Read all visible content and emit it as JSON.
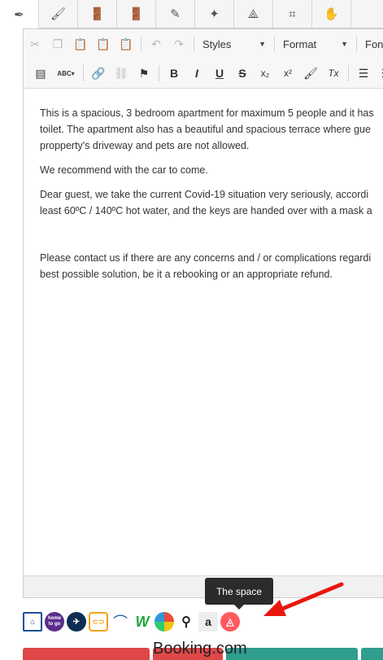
{
  "tabs": [
    {
      "icon": "pen-nib-icon",
      "glyph": "✒"
    },
    {
      "icon": "brush-icon",
      "glyph": "🖌"
    },
    {
      "icon": "door-icon",
      "glyph": "🚪"
    },
    {
      "icon": "door-open-icon",
      "glyph": "🚪"
    },
    {
      "icon": "pencil-icon",
      "glyph": "✎"
    },
    {
      "icon": "magic-wand-icon",
      "glyph": "✦"
    },
    {
      "icon": "drafting-compass-icon",
      "glyph": "⟁"
    },
    {
      "icon": "crop-icon",
      "glyph": "⌗"
    },
    {
      "icon": "hand-icon",
      "glyph": "✋"
    }
  ],
  "toolbar": {
    "styles_label": "Styles",
    "format_label": "Format",
    "font_label": "Font",
    "spell_label": "ABC",
    "bold": "B",
    "italic": "I",
    "underline": "U",
    "strike": "S",
    "subscript": "x₂",
    "superscript": "x²",
    "clear_format": "Tx"
  },
  "content": {
    "p1a": "This is a spacious, 3 bedroom apartment for maximum 5 people and it has",
    "p1b": "toilet. The apartment also has a beautiful and spacious terrace where gue",
    "p1c": "propperty's driveway and pets are not allowed.",
    "p2": "We recommend with the car to come.",
    "p3a": "Dear guest, we take the current Covid-19 situation very seriously, accordi",
    "p3b": "least 60ºC / 140ºC hot water, and the keys are handed over with a mask a",
    "p4a": "Please contact us if there are any concerns and / or complications regardi",
    "p4b": "best possible solution, be it a rebooking or an appropriate refund."
  },
  "tooltip": "The space",
  "bottom_text": "Booking.com",
  "colors": {
    "airbnb": "#ff5a5f",
    "arrow": "#e8170f",
    "tab_blue": "#1a5fa3",
    "red_button": "#e04848",
    "teal_button": "#2f9e8f"
  }
}
